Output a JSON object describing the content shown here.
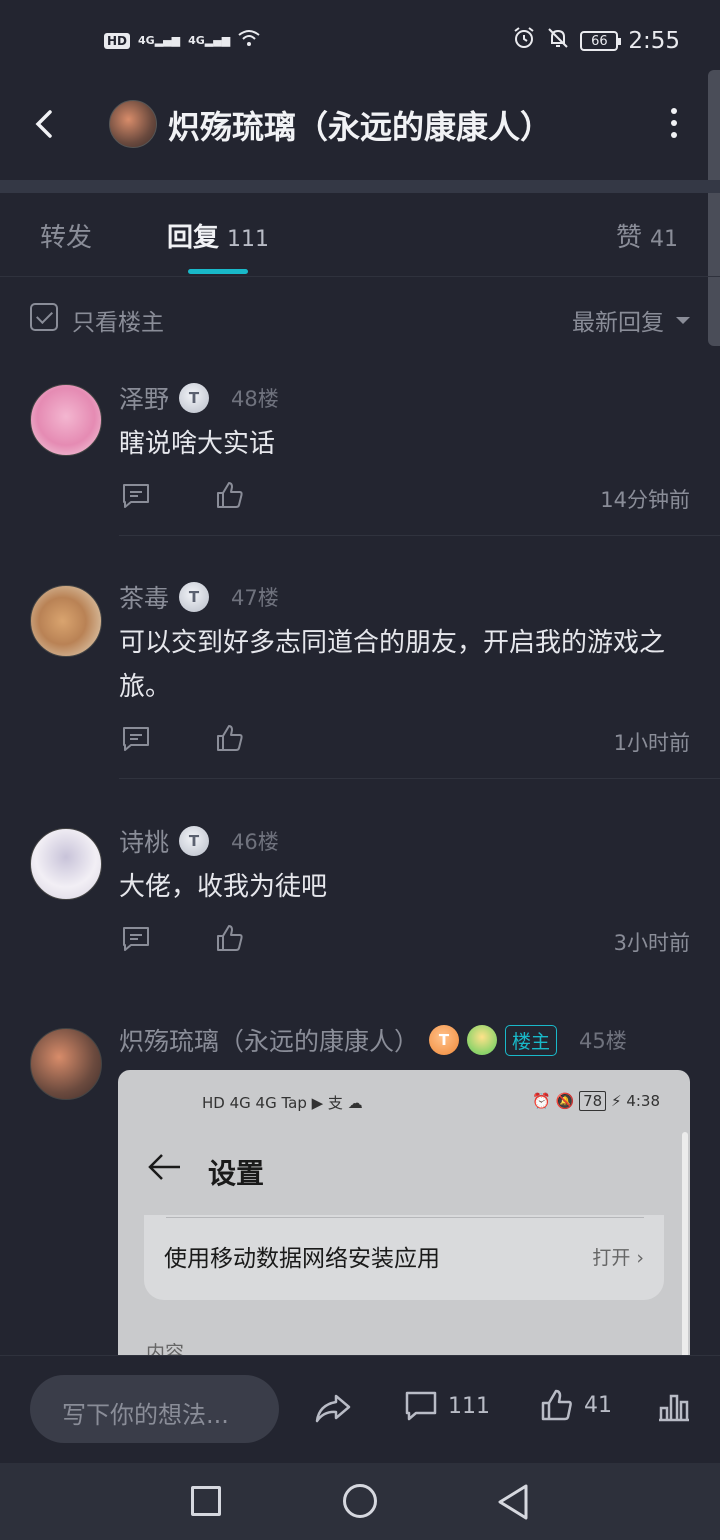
{
  "status_bar": {
    "left_indicators": [
      "HD",
      "4G",
      "4G"
    ],
    "battery": "66",
    "time": "2:55"
  },
  "header": {
    "title": "炽殇琉璃（永远的康康人）"
  },
  "tabs": [
    {
      "label": "转发",
      "count": ""
    },
    {
      "label": "回复",
      "count": "111"
    },
    {
      "label": "赞",
      "count": "41"
    }
  ],
  "filter": {
    "only_op_label": "只看楼主",
    "sort_label": "最新回复"
  },
  "comments": [
    {
      "name": "泽野",
      "badge": "T",
      "floor": "48楼",
      "text": "瞎说啥大实话",
      "time": "14分钟前"
    },
    {
      "name": "茶毒",
      "badge": "T",
      "floor": "47楼",
      "text": "可以交到好多志同道合的朋友，开启我的游戏之旅。",
      "time": "1小时前"
    },
    {
      "name": "诗桃",
      "badge": "T",
      "floor": "46楼",
      "text": "大佬，收我为徒吧",
      "time": "3小时前"
    },
    {
      "name": "炽殇琉璃（永远的康康人）",
      "badge": "T",
      "owner_tag": "楼主",
      "floor": "45楼"
    }
  ],
  "embedded_screenshot": {
    "status_left": "HD 4G 4G Tap ▶ 支 ☁",
    "battery": "78",
    "time": "4:38",
    "title": "设置",
    "row_label": "使用移动数据网络安装应用",
    "row_value": "打开",
    "section_label": "内容"
  },
  "bottom_bar": {
    "compose_placeholder": "写下你的想法...",
    "comment_count": "111",
    "like_count": "41"
  }
}
